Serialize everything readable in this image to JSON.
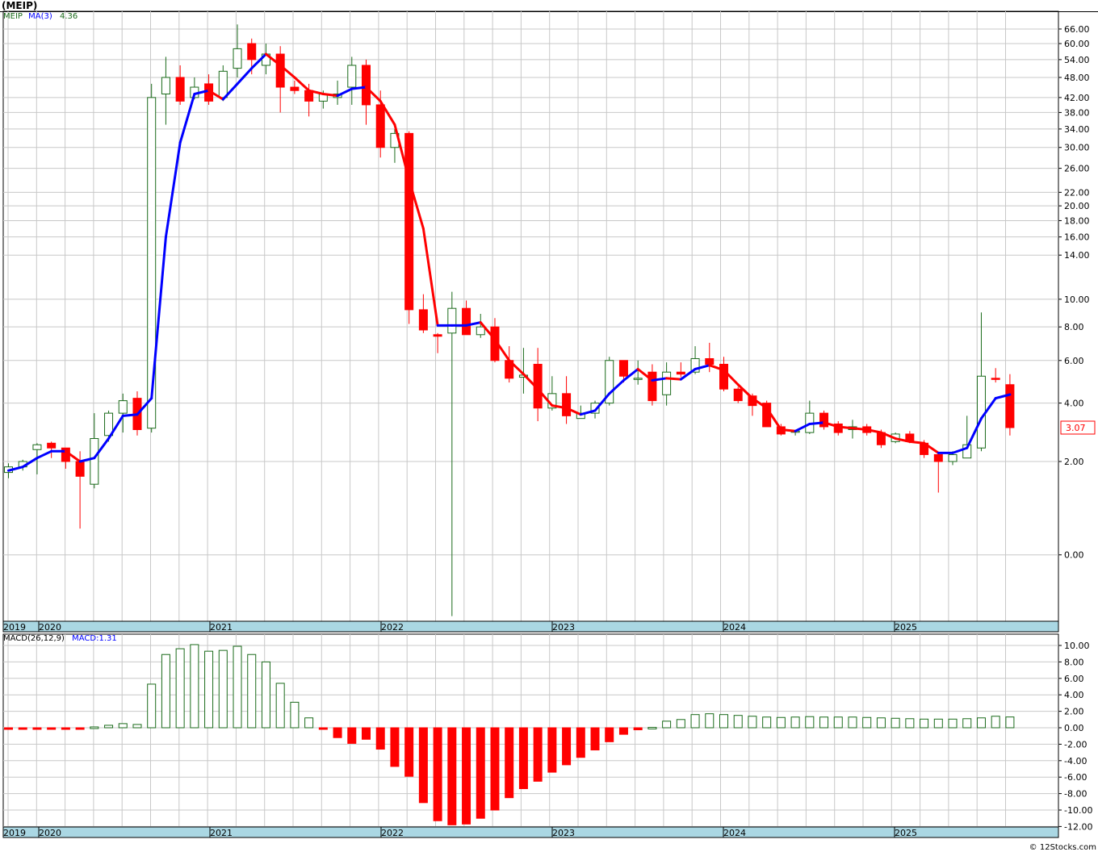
{
  "title": "(MEIP)",
  "credit": "© 12Stocks.com",
  "colors": {
    "up": "#1b6b1b",
    "down": "#ff0000",
    "ma_up": "#0000ff",
    "ma_down": "#ff0000",
    "axis_band": "#aad7e3",
    "grid": "#c8c8c8",
    "last_box": "#ff0000"
  },
  "price_legend": {
    "symbol": "MEIP",
    "ma_label": "MA(3)",
    "ma_value": "4.36"
  },
  "macd_legend": {
    "label": "MACD(26,12,9)",
    "value_label": "MACD:1.31"
  },
  "last_price_label": "3.07",
  "chart_data": [
    {
      "type": "candlestick",
      "scale": "log",
      "ytick_labels": [
        "66.00",
        "60.00",
        "54.00",
        "48.00",
        "42.00",
        "38.00",
        "34.00",
        "30.00",
        "26.00",
        "22.00",
        "20.00",
        "18.00",
        "16.00",
        "14.00",
        "10.00",
        "8.00",
        "6.00",
        "4.00",
        "2.00",
        "0.00"
      ],
      "xtick_labels": [
        "2019",
        "2020",
        "2021",
        "2022",
        "2023",
        "2024",
        "2025"
      ],
      "grid": true,
      "ma_period": 3,
      "candles": [
        {
          "o": 1.7,
          "h": 1.95,
          "l": 1.55,
          "c": 1.85
        },
        {
          "o": 1.85,
          "h": 2.05,
          "l": 1.75,
          "c": 2.0
        },
        {
          "o": 2.35,
          "h": 2.55,
          "l": 1.65,
          "c": 2.5
        },
        {
          "o": 2.55,
          "h": 2.6,
          "l": 2.1,
          "c": 2.4
        },
        {
          "o": 2.4,
          "h": 2.4,
          "l": 1.8,
          "c": 2.0
        },
        {
          "o": 2.0,
          "h": 2.3,
          "l": 0.45,
          "c": 1.6
        },
        {
          "o": 1.4,
          "h": 3.6,
          "l": 1.3,
          "c": 2.7
        },
        {
          "o": 2.8,
          "h": 3.7,
          "l": 2.6,
          "c": 3.6
        },
        {
          "o": 3.6,
          "h": 4.4,
          "l": 2.9,
          "c": 4.1
        },
        {
          "o": 4.2,
          "h": 4.5,
          "l": 2.8,
          "c": 3.0
        },
        {
          "o": 3.05,
          "h": 46.0,
          "l": 2.9,
          "c": 42.0
        },
        {
          "o": 43.0,
          "h": 55.0,
          "l": 35.0,
          "c": 48.0
        },
        {
          "o": 48.0,
          "h": 52.0,
          "l": 40.0,
          "c": 41.0
        },
        {
          "o": 42.0,
          "h": 48.0,
          "l": 41.5,
          "c": 45.0
        },
        {
          "o": 46.0,
          "h": 49.0,
          "l": 40.0,
          "c": 41.0
        },
        {
          "o": 42.0,
          "h": 52.0,
          "l": 41.0,
          "c": 50.0
        },
        {
          "o": 51.0,
          "h": 68.0,
          "l": 48.0,
          "c": 58.0
        },
        {
          "o": 60.0,
          "h": 62.0,
          "l": 49.0,
          "c": 54.0
        },
        {
          "o": 52.0,
          "h": 60.0,
          "l": 49.0,
          "c": 56.0
        },
        {
          "o": 56.0,
          "h": 59.0,
          "l": 38.0,
          "c": 45.0
        },
        {
          "o": 45.0,
          "h": 47.0,
          "l": 43.0,
          "c": 44.0
        },
        {
          "o": 44.0,
          "h": 46.0,
          "l": 37.0,
          "c": 41.0
        },
        {
          "o": 41.0,
          "h": 44.0,
          "l": 39.0,
          "c": 43.0
        },
        {
          "o": 42.0,
          "h": 47.0,
          "l": 40.0,
          "c": 43.0
        },
        {
          "o": 45.0,
          "h": 55.0,
          "l": 40.0,
          "c": 52.0
        },
        {
          "o": 52.0,
          "h": 54.0,
          "l": 35.0,
          "c": 40.0
        },
        {
          "o": 40.0,
          "h": 44.0,
          "l": 28.0,
          "c": 30.0
        },
        {
          "o": 30.0,
          "h": 34.0,
          "l": 27.0,
          "c": 33.0
        },
        {
          "o": 33.0,
          "h": 33.5,
          "l": 8.2,
          "c": 9.2
        },
        {
          "o": 9.2,
          "h": 10.4,
          "l": 7.6,
          "c": 7.8
        },
        {
          "o": 7.5,
          "h": 7.6,
          "l": 6.4,
          "c": 7.4
        },
        {
          "o": 7.6,
          "h": 10.6,
          "l": -0.8,
          "c": 9.3
        },
        {
          "o": 9.3,
          "h": 9.9,
          "l": 7.5,
          "c": 7.5
        },
        {
          "o": 7.5,
          "h": 8.9,
          "l": 7.3,
          "c": 8.0
        },
        {
          "o": 8.0,
          "h": 8.6,
          "l": 5.9,
          "c": 6.0
        },
        {
          "o": 6.0,
          "h": 6.8,
          "l": 4.9,
          "c": 5.1
        },
        {
          "o": 5.15,
          "h": 6.7,
          "l": 4.4,
          "c": 5.25
        },
        {
          "o": 5.8,
          "h": 6.7,
          "l": 3.3,
          "c": 3.8
        },
        {
          "o": 3.8,
          "h": 5.2,
          "l": 3.7,
          "c": 4.4
        },
        {
          "o": 4.4,
          "h": 5.2,
          "l": 3.2,
          "c": 3.5
        },
        {
          "o": 3.4,
          "h": 3.9,
          "l": 3.4,
          "c": 3.6
        },
        {
          "o": 3.6,
          "h": 4.1,
          "l": 3.4,
          "c": 4.0
        },
        {
          "o": 4.0,
          "h": 6.2,
          "l": 3.9,
          "c": 6.0
        },
        {
          "o": 6.0,
          "h": 6.0,
          "l": 4.9,
          "c": 5.2
        },
        {
          "o": 5.1,
          "h": 6.0,
          "l": 4.8,
          "c": 5.1
        },
        {
          "o": 5.4,
          "h": 5.8,
          "l": 3.9,
          "c": 4.1
        },
        {
          "o": 4.35,
          "h": 5.9,
          "l": 3.9,
          "c": 5.4
        },
        {
          "o": 5.4,
          "h": 5.9,
          "l": 5.15,
          "c": 5.3
        },
        {
          "o": 5.4,
          "h": 6.8,
          "l": 5.3,
          "c": 6.1
        },
        {
          "o": 6.1,
          "h": 7.0,
          "l": 5.4,
          "c": 5.8
        },
        {
          "o": 5.8,
          "h": 6.2,
          "l": 4.5,
          "c": 4.6
        },
        {
          "o": 4.6,
          "h": 4.7,
          "l": 4.0,
          "c": 4.1
        },
        {
          "o": 4.3,
          "h": 4.4,
          "l": 3.5,
          "c": 3.9
        },
        {
          "o": 4.0,
          "h": 4.1,
          "l": 3.1,
          "c": 3.1
        },
        {
          "o": 3.1,
          "h": 3.2,
          "l": 2.8,
          "c": 2.85
        },
        {
          "o": 2.95,
          "h": 2.95,
          "l": 2.8,
          "c": 2.95
        },
        {
          "o": 2.9,
          "h": 4.1,
          "l": 2.85,
          "c": 3.6
        },
        {
          "o": 3.6,
          "h": 3.7,
          "l": 3.0,
          "c": 3.1
        },
        {
          "o": 3.2,
          "h": 3.3,
          "l": 2.8,
          "c": 2.9
        },
        {
          "o": 3.0,
          "h": 3.35,
          "l": 2.7,
          "c": 3.1
        },
        {
          "o": 3.1,
          "h": 3.2,
          "l": 2.8,
          "c": 2.9
        },
        {
          "o": 2.9,
          "h": 3.0,
          "l": 2.4,
          "c": 2.5
        },
        {
          "o": 2.6,
          "h": 2.9,
          "l": 2.55,
          "c": 2.85
        },
        {
          "o": 2.85,
          "h": 2.95,
          "l": 2.55,
          "c": 2.6
        },
        {
          "o": 2.55,
          "h": 2.65,
          "l": 2.1,
          "c": 2.2
        },
        {
          "o": 2.2,
          "h": 2.25,
          "l": 1.2,
          "c": 2.0
        },
        {
          "o": 2.0,
          "h": 2.3,
          "l": 1.9,
          "c": 2.2
        },
        {
          "o": 2.1,
          "h": 3.5,
          "l": 2.1,
          "c": 2.5
        },
        {
          "o": 2.4,
          "h": 9.0,
          "l": 2.3,
          "c": 5.2
        },
        {
          "o": 5.1,
          "h": 5.6,
          "l": 4.9,
          "c": 5.05
        },
        {
          "o": 4.8,
          "h": 5.3,
          "l": 2.8,
          "c": 3.07
        }
      ],
      "ma": [
        1.75,
        1.85,
        2.1,
        2.3,
        2.3,
        2.0,
        2.1,
        2.7,
        3.5,
        3.55,
        4.2,
        16.0,
        31.0,
        43.0,
        44.0,
        41.5,
        46.0,
        51.0,
        56.0,
        52.0,
        48.0,
        44.0,
        43.0,
        42.5,
        44.5,
        45.0,
        41.0,
        35.0,
        24.0,
        17.0,
        8.1,
        8.1,
        8.1,
        8.3,
        7.2,
        6.0,
        5.3,
        4.6,
        3.9,
        3.8,
        3.55,
        3.7,
        4.4,
        5.0,
        5.55,
        5.0,
        5.1,
        5.05,
        5.55,
        5.75,
        5.5,
        4.8,
        4.2,
        3.8,
        3.0,
        2.95,
        3.2,
        3.25,
        3.1,
        3.05,
        3.0,
        2.9,
        2.7,
        2.6,
        2.55,
        2.25,
        2.25,
        2.4,
        3.4,
        4.2,
        4.36
      ]
    },
    {
      "type": "bar",
      "name": "MACD(26,12,9)",
      "ytick_labels": [
        "10.00",
        "8.00",
        "6.00",
        "4.00",
        "2.00",
        "0.00",
        "-2.00",
        "-4.00",
        "-6.00",
        "-8.00",
        "-10.00",
        "-12.00"
      ],
      "xtick_labels": [
        "2019",
        "2020",
        "2021",
        "2022",
        "2023",
        "2024",
        "2025"
      ],
      "grid": true,
      "values": [
        -0.15,
        -0.15,
        -0.1,
        -0.1,
        -0.1,
        -0.1,
        0.1,
        0.3,
        0.5,
        0.4,
        5.3,
        8.9,
        9.6,
        10.1,
        9.3,
        9.4,
        9.9,
        8.9,
        8.0,
        5.4,
        3.1,
        1.2,
        -0.1,
        -1.2,
        -1.9,
        -1.4,
        -2.6,
        -4.7,
        -5.9,
        -9.1,
        -11.3,
        -11.8,
        -11.7,
        -11.0,
        -10.0,
        -8.5,
        -7.4,
        -6.5,
        -5.4,
        -4.5,
        -3.6,
        -2.7,
        -1.7,
        -0.8,
        -0.25,
        0.05,
        0.8,
        1.0,
        1.6,
        1.7,
        1.6,
        1.5,
        1.4,
        1.3,
        1.25,
        1.3,
        1.35,
        1.3,
        1.3,
        1.3,
        1.25,
        1.2,
        1.15,
        1.1,
        1.05,
        1.05,
        1.05,
        1.1,
        1.2,
        1.4,
        1.31
      ]
    }
  ]
}
